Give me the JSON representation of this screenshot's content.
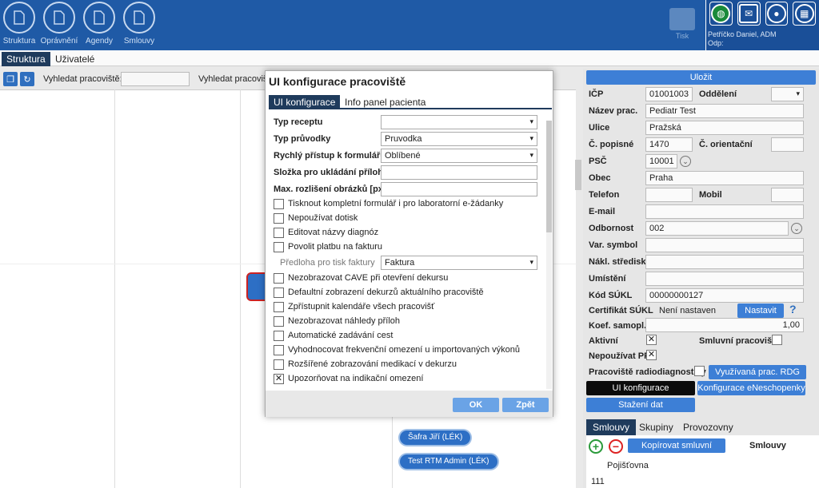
{
  "topnav": {
    "items": [
      {
        "label": "Struktura"
      },
      {
        "label": "Oprávnění"
      },
      {
        "label": "Agendy"
      },
      {
        "label": "Smlouvy"
      }
    ],
    "print_label": "Tisk",
    "user_name": "Petříčko Daniel, ADM",
    "odp_label": "Odp:"
  },
  "tabs": [
    {
      "label": "Struktura"
    },
    {
      "label": "Uživatelé"
    }
  ],
  "toolbar": {
    "search1_label": "Vyhledat pracoviště:",
    "search2_label": "Vyhledat pracoviš"
  },
  "tree_pills": [
    {
      "label": "Šafra Jiří (LÉK)"
    },
    {
      "label": "Test RTM Admin (LÉK)"
    }
  ],
  "right": {
    "save_label": "Uložit",
    "fields": {
      "icp_label": "IČP",
      "icp_value": "01001003",
      "oddeleni_label": "Oddělení",
      "nazev_label": "Název prac.",
      "nazev_value": "Pediatr Test",
      "ulice_label": "Ulice",
      "ulice_value": "Pražská",
      "cpopisne_label": "Č. popisné",
      "cpopisne_value": "1470",
      "corientacni_label": "Č. orientační",
      "psc_label": "PSČ",
      "psc_value": "10001",
      "obec_label": "Obec",
      "obec_value": "Praha",
      "telefon_label": "Telefon",
      "mobil_label": "Mobil",
      "email_label": "E-mail",
      "odbornost_label": "Odbornost",
      "odbornost_value": "002",
      "varsymbol_label": "Var. symbol",
      "naklstredisko_label": "Nákl. středisko",
      "umisteni_label": "Umístění",
      "kodsukl_label": "Kód SÚKL",
      "kodsukl_value": "00000000127",
      "certifikat_label": "Certifikát SÚKL",
      "certifikat_value": "Není nastaven",
      "nastavit_label": "Nastavit",
      "koef_label": "Koef. samopl.",
      "koef_value": "1,00",
      "aktivni_label": "Aktivní",
      "smluvni_label": "Smluvní pracoviště",
      "nepouzivatpp_label": "Nepoužívat PP",
      "radiodiag_label": "Pracoviště radiodiagnostiky",
      "vyuzivana_label": "Využívaná prac. RDG (0)",
      "uikonf_label": "UI konfigurace",
      "eneschopenky_label": "Konfigurace eNeschopenky",
      "stazeni_label": "Stažení dat"
    },
    "bottom_tabs": [
      {
        "label": "Smlouvy"
      },
      {
        "label": "Skupiny"
      },
      {
        "label": "Provozovny"
      }
    ],
    "kopirovat_label": "Kopírovat smluvní výkony",
    "smlouvy_header": "Smlouvy",
    "pojistovna_header": "Pojišťovna",
    "pojistovna_value": "111"
  },
  "modal": {
    "title": "UI konfigurace pracoviště",
    "tabs": [
      {
        "label": "UI konfigurace"
      },
      {
        "label": "Info panel pacienta"
      }
    ],
    "typ_receptu_label": "Typ receptu",
    "typ_receptu_value": "",
    "typ_pruvodky_label": "Typ průvodky",
    "typ_pruvodky_value": "Pruvodka",
    "rychly_pristup_label": "Rychlý přístup k formulářům",
    "rychly_pristup_value": "Oblíbené",
    "slozka_label": "Složka pro ukládání příloh",
    "max_rozliseni_label": "Max. rozlišení obrázků [px]",
    "predloha_label": "Předloha pro tisk faktury",
    "predloha_value": "Faktura",
    "checkboxes": [
      {
        "label": "Tisknout kompletní formulář i pro laboratorní e-žádanky",
        "checked": ""
      },
      {
        "label": "Nepoužívat dotisk",
        "checked": ""
      },
      {
        "label": "Editovat názvy diagnóz",
        "checked": ""
      },
      {
        "label": "Povolit platbu na fakturu",
        "checked": ""
      },
      {
        "label": "Nezobrazovat CAVE při otevření dekursu",
        "checked": ""
      },
      {
        "label": "Defaultní zobrazení dekurzů aktuálního pracoviště",
        "checked": ""
      },
      {
        "label": "Zpřístupnit kalendáře všech pracovišť",
        "checked": ""
      },
      {
        "label": "Nezobrazovat náhledy příloh",
        "checked": ""
      },
      {
        "label": "Automatické zadávání cest",
        "checked": ""
      },
      {
        "label": "Vyhodnocovat frekvenční omezení u importovaných výkonů",
        "checked": ""
      },
      {
        "label": "Rozšířené zobrazování medikací v dekurzu",
        "checked": ""
      },
      {
        "label": "Upozorňovat na indikační omezení",
        "checked": "✕"
      }
    ],
    "ok_label": "OK",
    "back_label": "Zpět"
  }
}
